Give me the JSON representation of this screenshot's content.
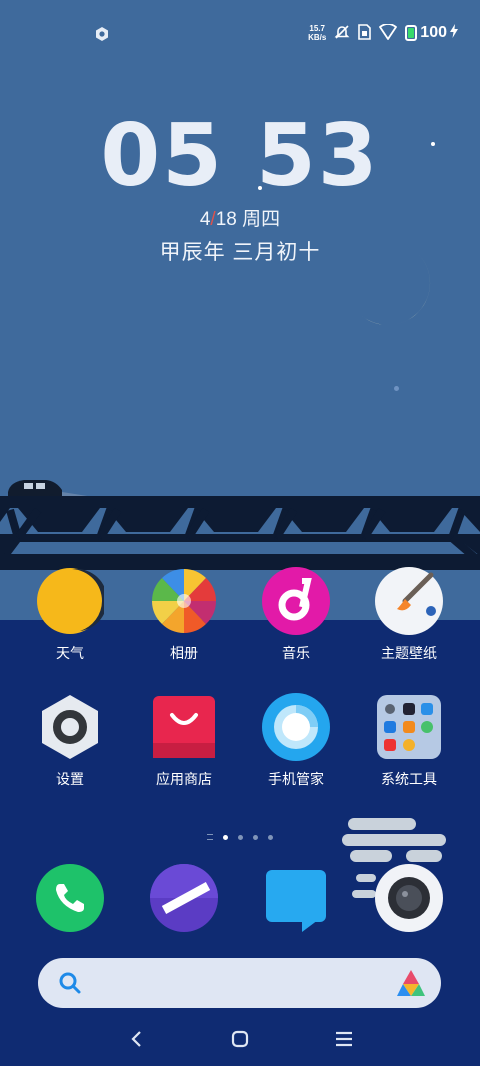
{
  "status_bar": {
    "speed_value": "15.7",
    "speed_unit": "KB/s",
    "battery_level": "100",
    "icons": [
      "settings-dot-icon",
      "mute-bell-icon",
      "sim-card-icon",
      "wifi-icon",
      "battery-icon",
      "charging-bolt-icon"
    ]
  },
  "clock": {
    "time": "05 53"
  },
  "date": {
    "month": "4",
    "day": "18",
    "weekday": "周四",
    "separator": "/"
  },
  "lunar": {
    "text": "甲辰年 三月初十"
  },
  "colors": {
    "date_separator": "#e0524b",
    "sky": "#3f6a9c",
    "sea": "#0f2b72"
  },
  "apps": {
    "row1": [
      "天气",
      "相册",
      "音乐",
      "主题壁纸"
    ],
    "row2": [
      "设置",
      "应用商店",
      "手机管家",
      "系统工具"
    ]
  },
  "dock": [
    "phone-icon",
    "browser-icon",
    "messages-icon",
    "camera-icon"
  ],
  "pager": {
    "pages": 4,
    "current": 1
  },
  "nav": [
    "back-icon",
    "home-icon",
    "menu-icon"
  ]
}
